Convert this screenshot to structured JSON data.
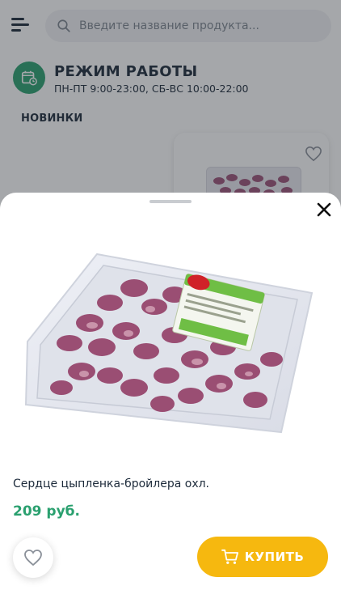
{
  "header": {
    "search_placeholder": "Введите название продукта..."
  },
  "work_hours": {
    "title": "РЕЖИМ РАБОТЫ",
    "text": "ПН-ПТ 9:00-23:00, СБ-ВС 10:00-22:00"
  },
  "sections": {
    "new_title": "НОВИНКИ"
  },
  "product": {
    "name": "Сердце цыпленка-бройлера охл.",
    "price": "209 руб.",
    "buy_label": "КУПИТЬ"
  },
  "colors": {
    "accent_green": "#2aa06f",
    "buy_yellow": "#f6b80f",
    "text_dark": "#1c2a3a"
  },
  "icons": [
    "menu-icon",
    "search-icon",
    "calendar-clock-icon",
    "heart-icon",
    "close-icon",
    "cart-icon"
  ]
}
